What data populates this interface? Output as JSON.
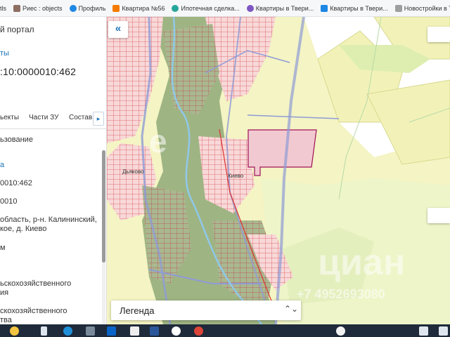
{
  "bookmarks": [
    {
      "label": "tls",
      "color": "#5f6368"
    },
    {
      "label": "Риес : objects",
      "color": "#8d6e63"
    },
    {
      "label": "Профиль",
      "color": "#1e88e5"
    },
    {
      "label": "Квартира №56",
      "color": "#f57c00"
    },
    {
      "label": "Ипотечная сделка...",
      "color": "#26a69a"
    },
    {
      "label": "Квартиры в Твери...",
      "color": "#7e57c2"
    },
    {
      "label": "Квартиры в Твери...",
      "color": "#1e88e5"
    },
    {
      "label": "Новостройки в Тве...",
      "color": "#9e9e9e"
    }
  ],
  "panel": {
    "title": "й портал",
    "link": "ты",
    "cadastral": ":10:0000010:462",
    "tabs": [
      "ьекты",
      "Части ЗУ",
      "Состав"
    ],
    "tab_arrow": "▸",
    "rows": [
      {
        "text": "ьзование",
        "style": "row"
      },
      {
        "text": "а",
        "style": "sub"
      },
      {
        "text": "0010:462",
        "style": "row"
      },
      {
        "text": "0010",
        "style": "row"
      },
      {
        "text": "область, р-н. Калининский,",
        "style": "row"
      },
      {
        "text": "кое, д. Киево",
        "style": "row"
      },
      {
        "text": "м",
        "style": "row"
      },
      {
        "text": "ьскохозяйственного",
        "style": "row"
      },
      {
        "text": "ия",
        "style": "row"
      },
      {
        "text": "скохозяйственного",
        "style": "row"
      },
      {
        "text": "тва",
        "style": "row"
      }
    ]
  },
  "map": {
    "collapse_label": "«",
    "legend_label": "Легенда",
    "legend_arrow": "⌃⌄",
    "place_labels": [
      "Дьяково",
      "Киево"
    ],
    "watermark_main": "циан",
    "watermark_phone": "+7 4952693080"
  },
  "colors": {
    "accent": "#1a73b8",
    "parcel_fill": "#f4c6cf",
    "parcel_stroke": "#a0105a",
    "forest": "#8fa878",
    "field": "#f2f2b8",
    "road": "#8f9bd6"
  },
  "taskbar": {
    "icons": [
      "start-icon",
      "search-icon",
      "task-view-icon",
      "edge-icon",
      "outlook-icon",
      "word-icon",
      "yandex-icon",
      "chrome-icon",
      "help-icon",
      "keyboard-icon",
      "monitor-icon"
    ]
  }
}
